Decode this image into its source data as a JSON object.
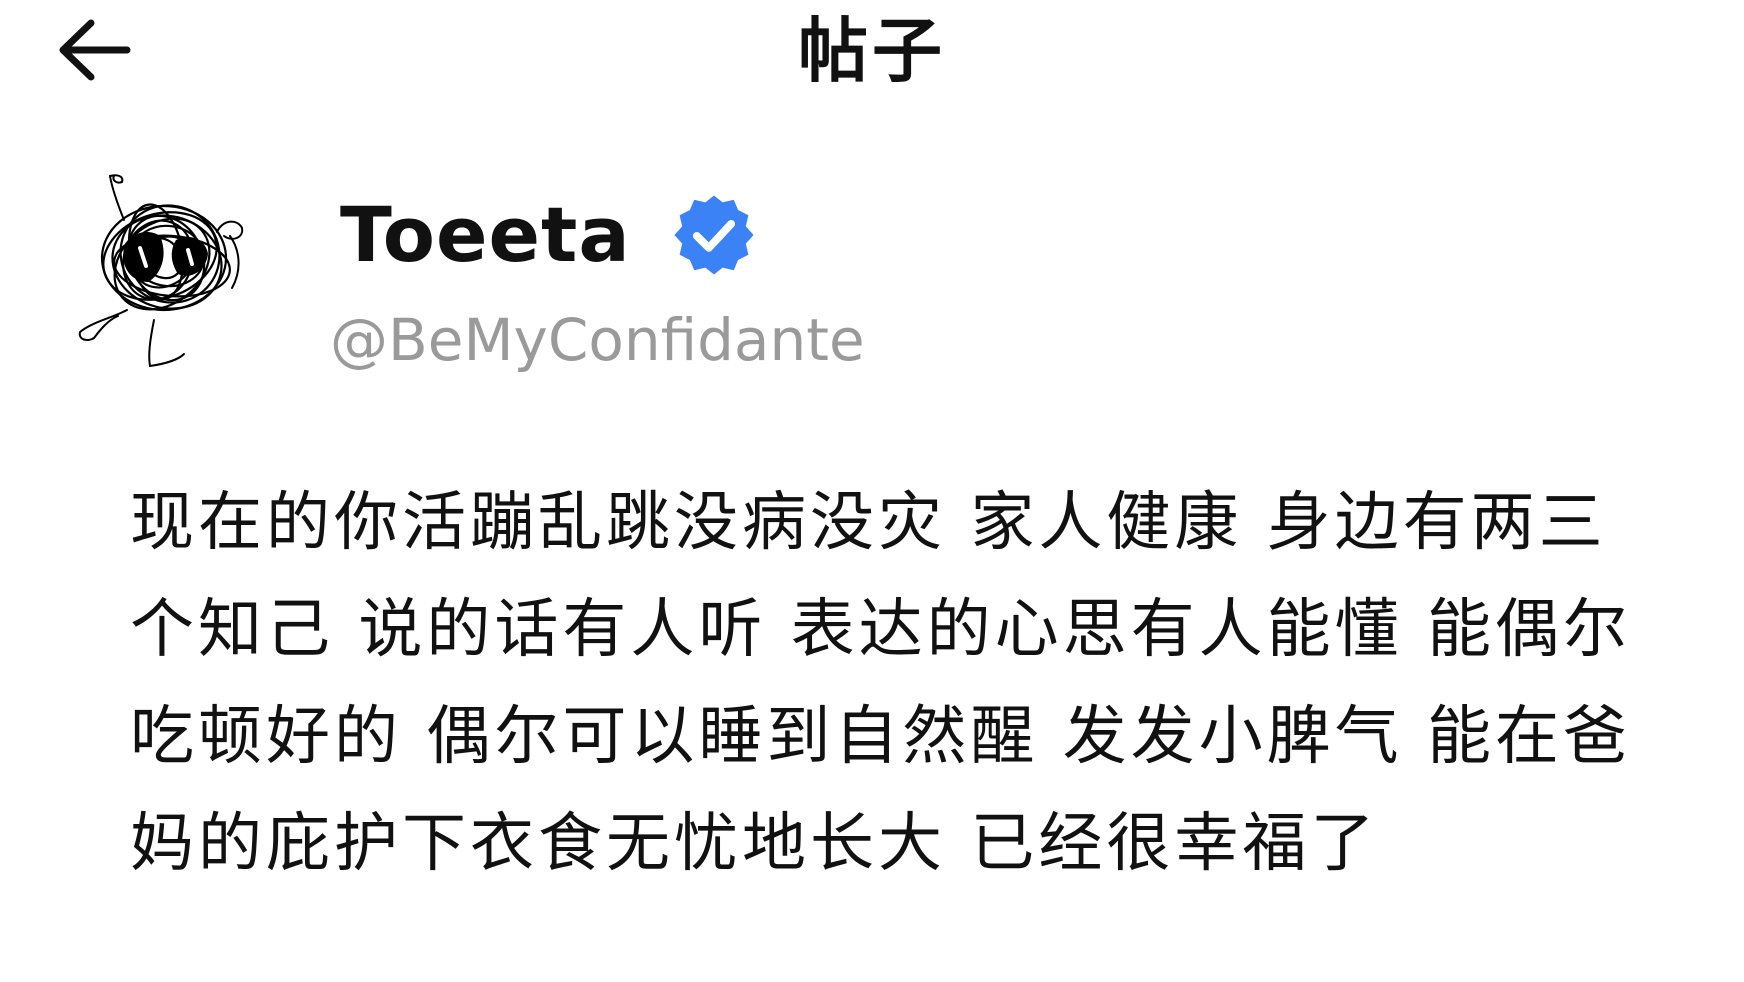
{
  "header": {
    "title": "帖子",
    "back_icon": "arrow-left-icon"
  },
  "post": {
    "author": {
      "display_name": "Toeeta",
      "handle": "@BeMyConfidante",
      "verified": true,
      "verified_icon": "verified-badge-icon",
      "avatar_icon": "scribble-doodle-avatar"
    },
    "lines": [
      "现在的你活蹦乱跳没病没灾 家人健康 身边有两三",
      "个知己 说的话有人听 表达的心思有人能懂 能偶尔",
      "吃顿好的 偶尔可以睡到自然醒 发发小脾气 能在爸",
      "妈的庇护下衣食无忧地长大 已经很幸福了"
    ]
  },
  "colors": {
    "text": "#111111",
    "handle": "#9a9a9a",
    "verified": "#3b82f6",
    "background": "#ffffff"
  }
}
